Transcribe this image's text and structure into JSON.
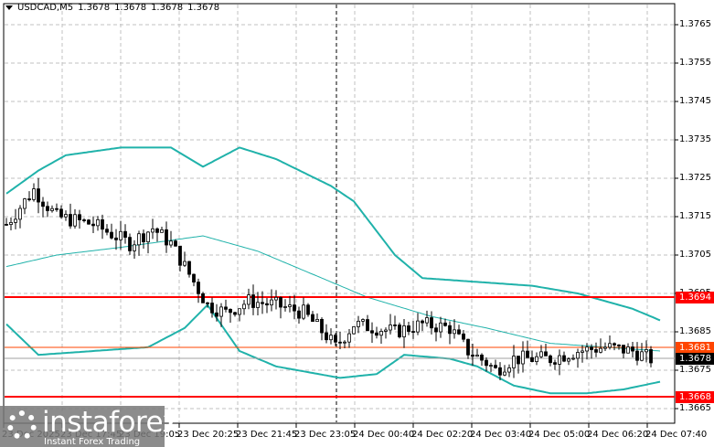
{
  "header": {
    "symbol": "USDCAD,M5",
    "ohlc": [
      "1.3678",
      "1.3678",
      "1.3678",
      "1.3678"
    ]
  },
  "price_axis": [
    "1.3765",
    "1.3755",
    "1.3745",
    "1.3735",
    "1.3725",
    "1.3715",
    "1.3705",
    "1.3695",
    "1.3685",
    "1.3675",
    "1.3665"
  ],
  "time_axis": [
    "23 Dec 2025",
    "23 Dec 17:45",
    "23 Dec 19:05",
    "23 Dec 20:25",
    "23 Dec 21:45",
    "23 Dec 23:05",
    "24 Dec 00:40",
    "24 Dec 02:20",
    "24 Dec 03:40",
    "24 Dec 05:00",
    "24 Dec 06:20",
    "24 Dec 07:40"
  ],
  "levels": [
    {
      "label": "1.3694",
      "price": 1.3694,
      "color": "#ff0000"
    },
    {
      "label": "1.3681",
      "price": 1.3681,
      "color": "#ff4500"
    },
    {
      "label": "1.3678",
      "price": 1.3678,
      "color": "#000000"
    },
    {
      "label": "1.3668",
      "price": 1.3668,
      "color": "#ff0000"
    }
  ],
  "watermark": {
    "brand": "instaforex",
    "tagline": "Instant Forex Trading"
  },
  "chart_data": {
    "type": "candlestick",
    "ylim": [
      1.3661,
      1.3771
    ],
    "bars": 142,
    "close_keypoints": [
      [
        0,
        1.3713
      ],
      [
        6,
        1.3722
      ],
      [
        11,
        1.3715
      ],
      [
        19,
        1.3713
      ],
      [
        27,
        1.3708
      ],
      [
        32,
        1.3712
      ],
      [
        36,
        1.3708
      ],
      [
        40,
        1.37
      ],
      [
        44,
        1.3692
      ],
      [
        48,
        1.369
      ],
      [
        53,
        1.3693
      ],
      [
        59,
        1.3692
      ],
      [
        65,
        1.369
      ],
      [
        70,
        1.3684
      ],
      [
        72,
        1.3681
      ],
      [
        76,
        1.3687
      ],
      [
        81,
        1.3686
      ],
      [
        85,
        1.3685
      ],
      [
        91,
        1.3687
      ],
      [
        97,
        1.3686
      ],
      [
        101,
        1.368
      ],
      [
        105,
        1.3677
      ],
      [
        107,
        1.3675
      ],
      [
        111,
        1.3678
      ],
      [
        119,
        1.3678
      ],
      [
        125,
        1.368
      ],
      [
        131,
        1.3681
      ],
      [
        137,
        1.368
      ],
      [
        141,
        1.3678
      ]
    ],
    "upper_band": [
      [
        0,
        1.3721
      ],
      [
        7,
        1.3727
      ],
      [
        13,
        1.3731
      ],
      [
        25,
        1.3733
      ],
      [
        36,
        1.3733
      ],
      [
        43,
        1.3728
      ],
      [
        51,
        1.3733
      ],
      [
        59,
        1.373
      ],
      [
        71,
        1.3723
      ],
      [
        76,
        1.3719
      ],
      [
        85,
        1.3705
      ],
      [
        91,
        1.3699
      ],
      [
        103,
        1.3698
      ],
      [
        115,
        1.3697
      ],
      [
        125,
        1.3695
      ],
      [
        137,
        1.3691
      ],
      [
        143,
        1.3688
      ]
    ],
    "middle_band": [
      [
        0,
        1.3702
      ],
      [
        11,
        1.3705
      ],
      [
        25,
        1.3707
      ],
      [
        43,
        1.371
      ],
      [
        55,
        1.3706
      ],
      [
        67,
        1.37
      ],
      [
        79,
        1.3694
      ],
      [
        93,
        1.3689
      ],
      [
        105,
        1.3686
      ],
      [
        119,
        1.3682
      ],
      [
        131,
        1.3681
      ],
      [
        143,
        1.368
      ]
    ],
    "lower_band": [
      [
        0,
        1.3687
      ],
      [
        7,
        1.3679
      ],
      [
        19,
        1.368
      ],
      [
        31,
        1.3681
      ],
      [
        39,
        1.3686
      ],
      [
        44,
        1.3692
      ],
      [
        51,
        1.368
      ],
      [
        59,
        1.3676
      ],
      [
        73,
        1.3673
      ],
      [
        81,
        1.3674
      ],
      [
        87,
        1.3679
      ],
      [
        97,
        1.3678
      ],
      [
        103,
        1.3676
      ],
      [
        111,
        1.3671
      ],
      [
        119,
        1.3669
      ],
      [
        127,
        1.3669
      ],
      [
        135,
        1.367
      ],
      [
        143,
        1.3672
      ]
    ]
  }
}
